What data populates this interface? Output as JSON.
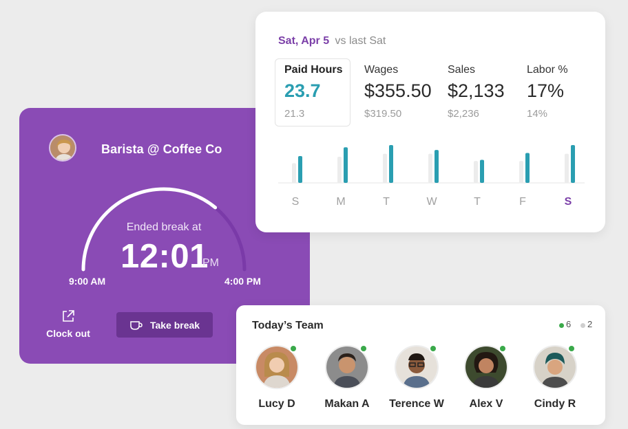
{
  "clock": {
    "title": "Barista @ Coffee Co",
    "ended_label": "Ended break at",
    "time": "12:01",
    "ampm": "PM",
    "shift_start": "9:00 AM",
    "shift_end": "4:00 PM",
    "shift_progress": 0.72,
    "clock_out_label": "Clock out",
    "take_break_label": "Take break",
    "accent": "#8a4bb5"
  },
  "stats": {
    "date": "Sat, Apr 5",
    "compare": "vs last Sat",
    "metrics": [
      {
        "label": "Paid Hours",
        "value": "23.7",
        "previous": "21.3"
      },
      {
        "label": "Wages",
        "value": "$355.50",
        "previous": "$319.50"
      },
      {
        "label": "Sales",
        "value": "$2,133",
        "previous": "$2,236"
      },
      {
        "label": "Labor %",
        "value": "17%",
        "previous": "14%"
      }
    ],
    "teal": "#2a9eb1"
  },
  "chart_data": {
    "type": "bar",
    "categories": [
      "S",
      "M",
      "T",
      "W",
      "T",
      "F",
      "S"
    ],
    "series": [
      {
        "values": [
          0.52,
          0.69,
          0.77,
          0.77,
          0.58,
          0.58,
          0.77
        ]
      },
      {
        "values": [
          0.71,
          0.94,
          1.0,
          0.87,
          0.61,
          0.79,
          1.0
        ]
      }
    ],
    "highlight_index": 6,
    "colors": [
      "#ececec",
      "#2a9eb1"
    ]
  },
  "team": {
    "title": "Today’s Team",
    "online_count": "6",
    "offline_count": "2",
    "members": [
      {
        "name": "Lucy D"
      },
      {
        "name": "Makan A"
      },
      {
        "name": "Terence W"
      },
      {
        "name": "Alex V"
      },
      {
        "name": "Cindy R"
      }
    ]
  }
}
